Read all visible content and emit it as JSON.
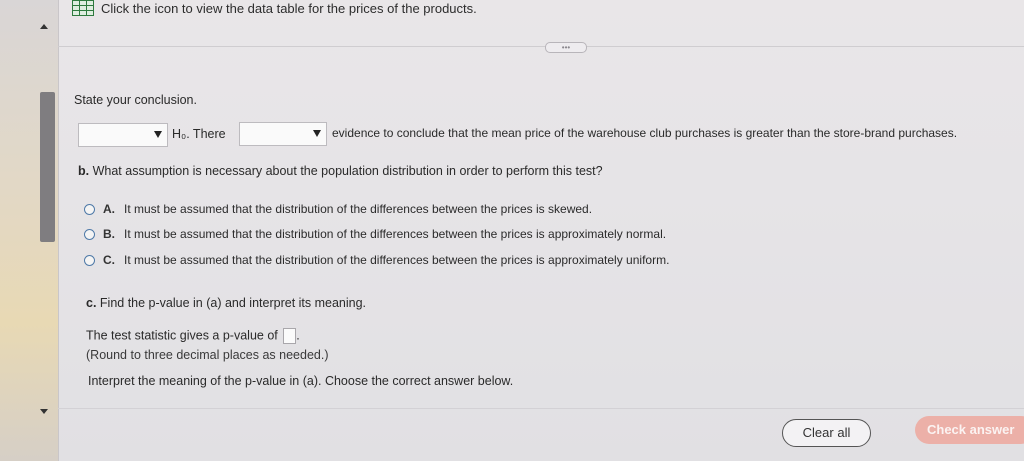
{
  "header": {
    "table_link_text": "Click the icon to view the data table for the prices of the products.",
    "table_icon": "data-table-icon"
  },
  "conclusion": {
    "prompt": "State your conclusion.",
    "select1_value": "",
    "h0_text": "H₀. There",
    "select2_value": "",
    "tail_text": "evidence to conclude that the mean price of the warehouse club purchases is greater than the store-brand purchases."
  },
  "part_b": {
    "letter": "b.",
    "question": "What assumption is necessary about the population distribution in order to perform this test?",
    "options": [
      {
        "letter": "A.",
        "text": "It must be assumed that the distribution of the differences between the prices is skewed."
      },
      {
        "letter": "B.",
        "text": "It must be assumed that the distribution of the differences between the prices is approximately normal."
      },
      {
        "letter": "C.",
        "text": "It must be assumed that the distribution of the differences between the prices is approximately uniform."
      }
    ]
  },
  "part_c": {
    "letter": "c.",
    "question": "Find the p-value in (a) and interpret its meaning.",
    "pvalue_text": "The test statistic gives a p-value of",
    "pvalue_input": "",
    "round_note": "(Round to three decimal places as needed.)",
    "interpret_prompt": "Interpret the meaning of the p-value in (a). Choose the correct answer below."
  },
  "footer": {
    "clear_label": "Clear all",
    "check_label": "Check answer"
  },
  "colors": {
    "accent_check": "#ecb0a8",
    "radio_border": "#4f7aa8",
    "icon_green": "#2e7a3e"
  }
}
